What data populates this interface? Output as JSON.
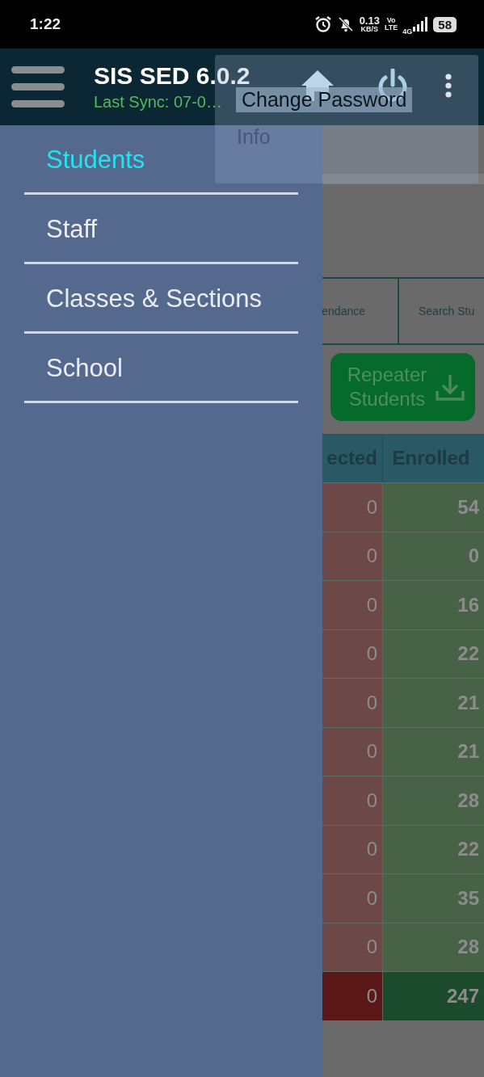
{
  "status_bar": {
    "time": "1:22",
    "network_speed": "0.13",
    "speed_unit": "KB/S",
    "volte_top": "Vo",
    "volte_bottom": "LTE",
    "network_type": "4G",
    "battery": "58"
  },
  "app_bar": {
    "title": "SIS SED 6.0.2",
    "subtitle": "Last Sync: 07-0…"
  },
  "overflow_menu": [
    {
      "label": "Change Password"
    },
    {
      "label": "Info"
    }
  ],
  "drawer": {
    "items": [
      {
        "label": "Students",
        "selected": true
      },
      {
        "label": "Staff",
        "selected": false
      },
      {
        "label": "Classes & Sections",
        "selected": false
      },
      {
        "label": "School",
        "selected": false
      }
    ]
  },
  "background": {
    "tabs": [
      "endance",
      "Search Stu"
    ],
    "button": "Repeater Students",
    "table": {
      "columns": [
        "ected",
        "Enrolled"
      ],
      "rows": [
        [
          "0",
          "54"
        ],
        [
          "0",
          "0"
        ],
        [
          "0",
          "16"
        ],
        [
          "0",
          "22"
        ],
        [
          "0",
          "21"
        ],
        [
          "0",
          "21"
        ],
        [
          "0",
          "28"
        ],
        [
          "0",
          "22"
        ],
        [
          "0",
          "35"
        ],
        [
          "0",
          "28"
        ]
      ],
      "total": [
        "0",
        "247"
      ]
    }
  }
}
